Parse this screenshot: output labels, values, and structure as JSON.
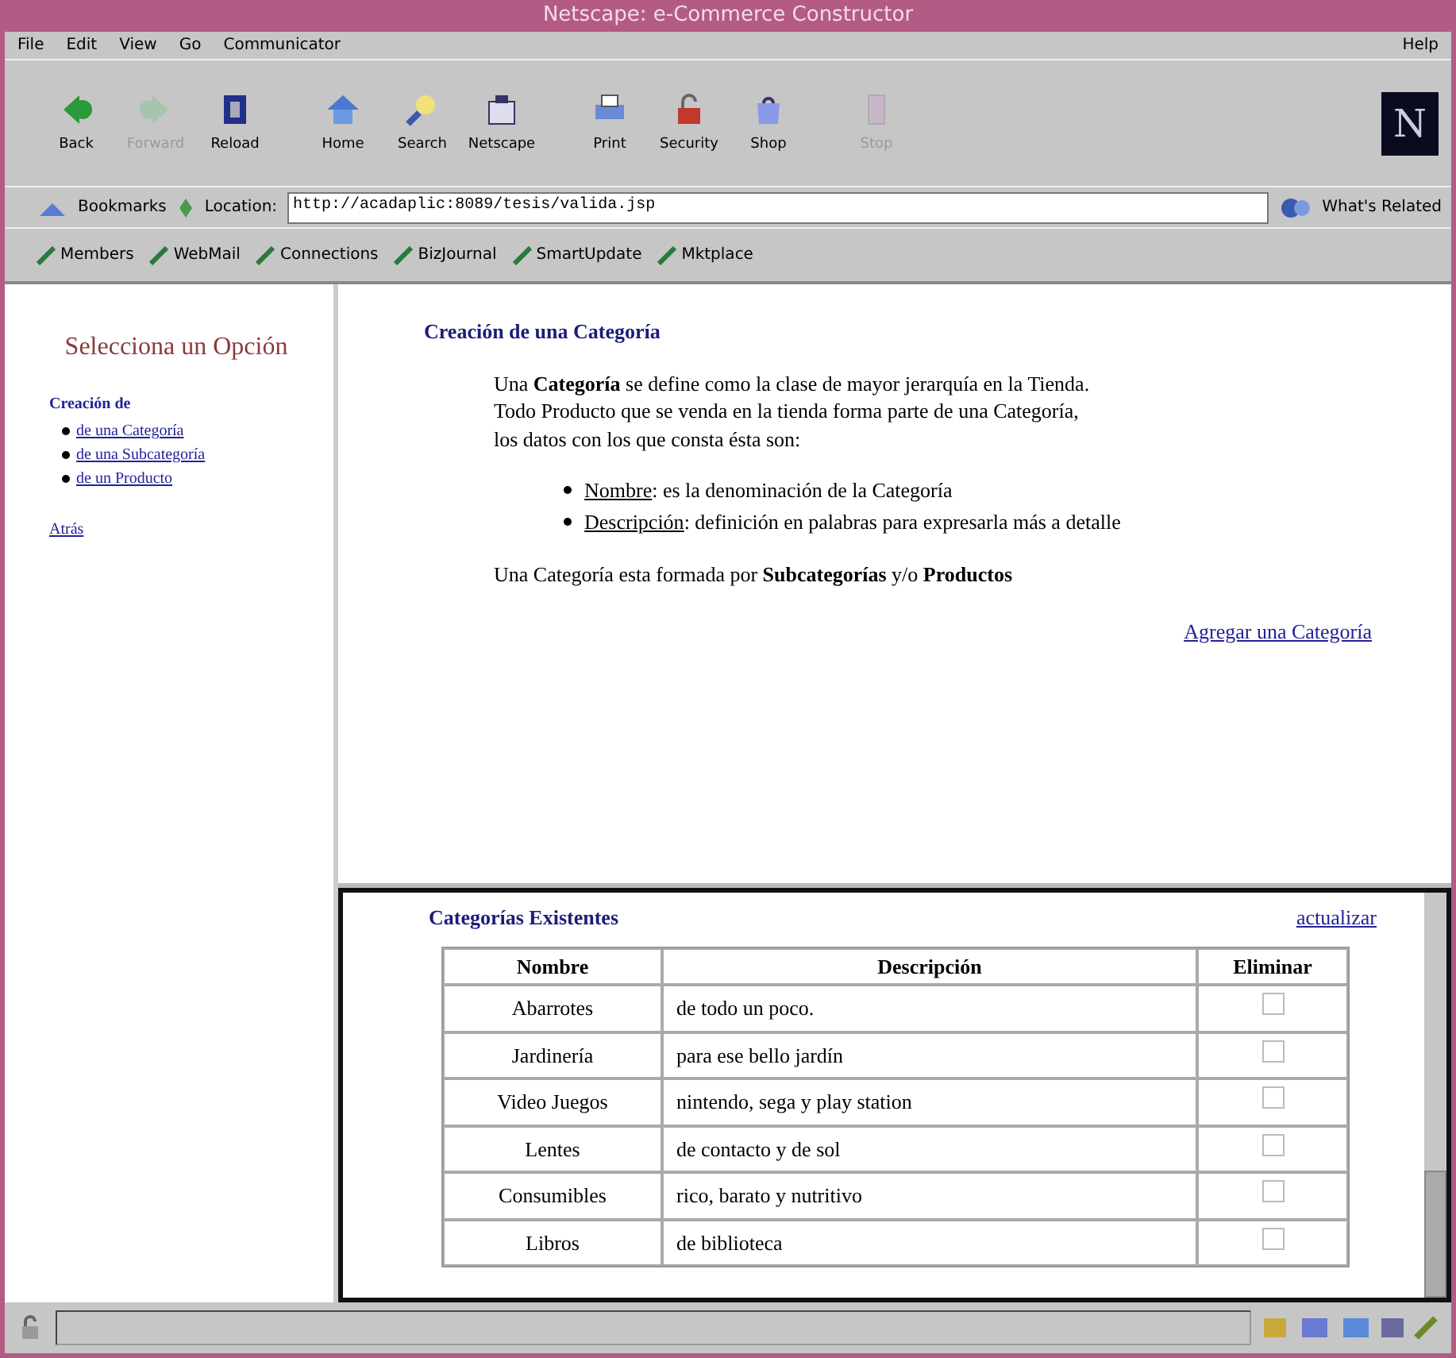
{
  "window": {
    "title": "Netscape: e-Commerce Constructor"
  },
  "menu": [
    "File",
    "Edit",
    "View",
    "Go",
    "Communicator"
  ],
  "menu_right": "Help",
  "toolbar": [
    {
      "label": "Back",
      "disabled": false
    },
    {
      "label": "Forward",
      "disabled": true
    },
    {
      "label": "Reload",
      "disabled": false
    },
    {
      "label": "Home",
      "disabled": false
    },
    {
      "label": "Search",
      "disabled": false
    },
    {
      "label": "Netscape",
      "disabled": false
    },
    {
      "label": "Print",
      "disabled": false
    },
    {
      "label": "Security",
      "disabled": false
    },
    {
      "label": "Shop",
      "disabled": false
    },
    {
      "label": "Stop",
      "disabled": true
    }
  ],
  "logo": "N",
  "location": {
    "bookmarks": "Bookmarks",
    "label": "Location:",
    "url": "http://acadaplic:8089/tesis/valida.jsp",
    "related": "What's Related"
  },
  "personal_toolbar": [
    "Members",
    "WebMail",
    "Connections",
    "BizJournal",
    "SmartUpdate",
    "Mktplace"
  ],
  "sidebar": {
    "title": "Selecciona un Opción",
    "heading": "Creación de",
    "links": [
      "de una Categoría",
      "de una Subcategoría",
      "de un Producto"
    ],
    "back": "Atrás"
  },
  "main": {
    "title": "Creación de una Categoría",
    "intro": "Una **Categoría** se define como la clase de mayor jerarquía en la Tienda.\n     Todo Producto que se venda en la tienda forma parte de una Categoría,\nlos datos con los que consta ésta son:",
    "fields": [
      {
        "term": "Nombre",
        "text": ": es la denominación de la Categoría"
      },
      {
        "term": "Descripción",
        "text": ": definición en palabras para expresarla más a detalle"
      }
    ],
    "note": "Una Categoría esta formada por **Subcategorías** y/o **Productos**",
    "add_link": "Agregar una Categoría"
  },
  "existing": {
    "title": "Categorías Existentes",
    "refresh": "actualizar",
    "columns": [
      "Nombre",
      "Descripción",
      "Eliminar"
    ],
    "rows": [
      {
        "name": "Abarrotes",
        "description": "de todo un poco.",
        "checked": false
      },
      {
        "name": "Jardinería",
        "description": "para ese bello jardín",
        "checked": false
      },
      {
        "name": "Video Juegos",
        "description": "nintendo, sega y play station",
        "checked": false
      },
      {
        "name": "Lentes",
        "description": "de contacto y de sol",
        "checked": false
      },
      {
        "name": "Consumibles",
        "description": "rico, barato y nutritivo",
        "checked": false
      },
      {
        "name": "Libros",
        "description": "de biblioteca",
        "checked": false
      }
    ]
  }
}
